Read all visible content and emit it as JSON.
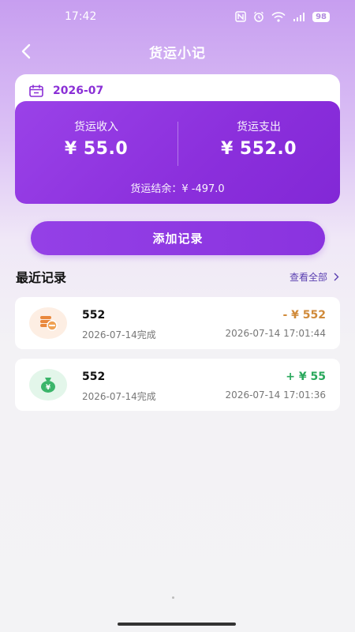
{
  "status_bar": {
    "time": "17:42",
    "battery": "98",
    "network": "5G"
  },
  "header": {
    "title": "货运小记"
  },
  "summary": {
    "month": "2026-07",
    "income_label": "货运收入",
    "income_value": "¥ 55.0",
    "expense_label": "货运支出",
    "expense_value": "¥ 552.0",
    "balance_text": "货运结余：¥ -497.0"
  },
  "actions": {
    "add_label": "添加记录"
  },
  "recent": {
    "title": "最近记录",
    "view_all": "查看全部",
    "items": [
      {
        "title": "552",
        "subtitle": "2026-07-14完成",
        "amount": "- ¥ 552",
        "time": "2026-07-14 17:01:44",
        "type": "expense",
        "icon": "coins-icon"
      },
      {
        "title": "552",
        "subtitle": "2026-07-14完成",
        "amount": "+ ¥ 55",
        "time": "2026-07-14 17:01:36",
        "type": "income",
        "icon": "money-bag-icon"
      }
    ]
  },
  "colors": {
    "accent": "#8b2fdc",
    "expense": "#d08a3a",
    "income": "#2aa85c",
    "expense_bg": "#fdeee3",
    "income_bg": "#e3f6ea"
  }
}
